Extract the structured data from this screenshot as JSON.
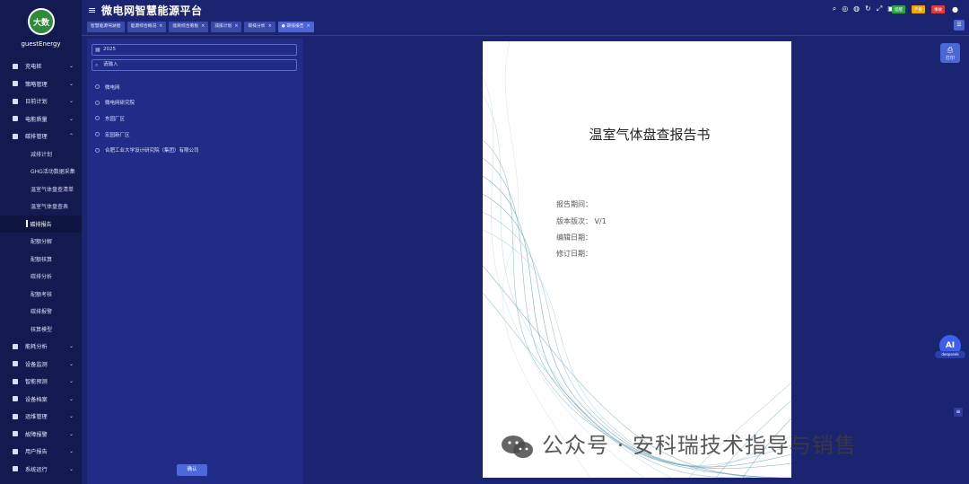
{
  "user": {
    "name": "guestEnergy",
    "logo_text": "大数"
  },
  "header": {
    "title": "微电网智慧能源平台"
  },
  "top_icons": [
    "search-icon",
    "globe-icon",
    "mute-icon",
    "refresh-icon",
    "fullscreen-icon",
    "image-icon",
    "shirt-icon"
  ],
  "badges": [
    {
      "label": "提醒",
      "color": "#28a745"
    },
    {
      "label": "严重",
      "color": "#f0a500"
    },
    {
      "label": "事故",
      "color": "#e03b3b"
    }
  ],
  "tabs": [
    {
      "label": "智慧能源驾驶舱",
      "closable": false,
      "active": false
    },
    {
      "label": "能源综合概况",
      "closable": true,
      "active": false
    },
    {
      "label": "能耗综合看板",
      "closable": true,
      "active": false
    },
    {
      "label": "减排计划",
      "closable": true,
      "active": false
    },
    {
      "label": "碳排分析",
      "closable": true,
      "active": false
    },
    {
      "label": "碳排报告",
      "closable": true,
      "active": true
    }
  ],
  "menu": [
    {
      "label": "充电桩",
      "icon": "charger-icon"
    },
    {
      "label": "策略管理",
      "icon": "strategy-icon"
    },
    {
      "label": "日前计划",
      "icon": "plan-icon"
    },
    {
      "label": "电能质量",
      "icon": "power-icon"
    },
    {
      "label": "碳排管理",
      "icon": "carbon-icon",
      "expanded": true
    }
  ],
  "submenu": [
    {
      "label": "减排计划",
      "active": false
    },
    {
      "label": "GHG活动数据采集",
      "active": false
    },
    {
      "label": "温室气体盘查清单",
      "active": false
    },
    {
      "label": "温室气体盘查表",
      "active": false
    },
    {
      "label": "碳排报告",
      "active": true
    },
    {
      "label": "配额分解",
      "active": false
    },
    {
      "label": "配额核算",
      "active": false
    },
    {
      "label": "碳排分析",
      "active": false
    },
    {
      "label": "配额考核",
      "active": false
    },
    {
      "label": "碳排报警",
      "active": false
    },
    {
      "label": "核算模型",
      "active": false
    }
  ],
  "menu_bottom": [
    {
      "label": "能耗分析",
      "icon": "analysis-icon"
    },
    {
      "label": "设备监测",
      "icon": "monitor-icon"
    },
    {
      "label": "智能预测",
      "icon": "forecast-icon"
    },
    {
      "label": "设备档案",
      "icon": "archive-icon"
    },
    {
      "label": "运维管理",
      "icon": "maintenance-icon"
    },
    {
      "label": "故障报警",
      "icon": "alarm-icon"
    },
    {
      "label": "用户报告",
      "icon": "report-icon"
    },
    {
      "label": "系统运行",
      "icon": "system-icon"
    }
  ],
  "panel": {
    "year": "2025",
    "search_placeholder": "请输入",
    "tree": [
      "微电网",
      "微电网研究院",
      "东园厂区",
      "宏园新厂区",
      "合肥工业大学设计研究院（集团）有限公司"
    ],
    "confirm_label": "确认"
  },
  "doc": {
    "title": "温室气体盘查报告书",
    "period_label": "报告期间：",
    "version_label": "版本版次：",
    "version_value": "V/1",
    "edit_label": "编辑日期：",
    "revise_label": "修订日期："
  },
  "right": {
    "print_label": "打印",
    "ai_label": "AI",
    "ai_sub": "deepseek"
  },
  "watermark": "公众号 · 安科瑞技术指导与销售"
}
